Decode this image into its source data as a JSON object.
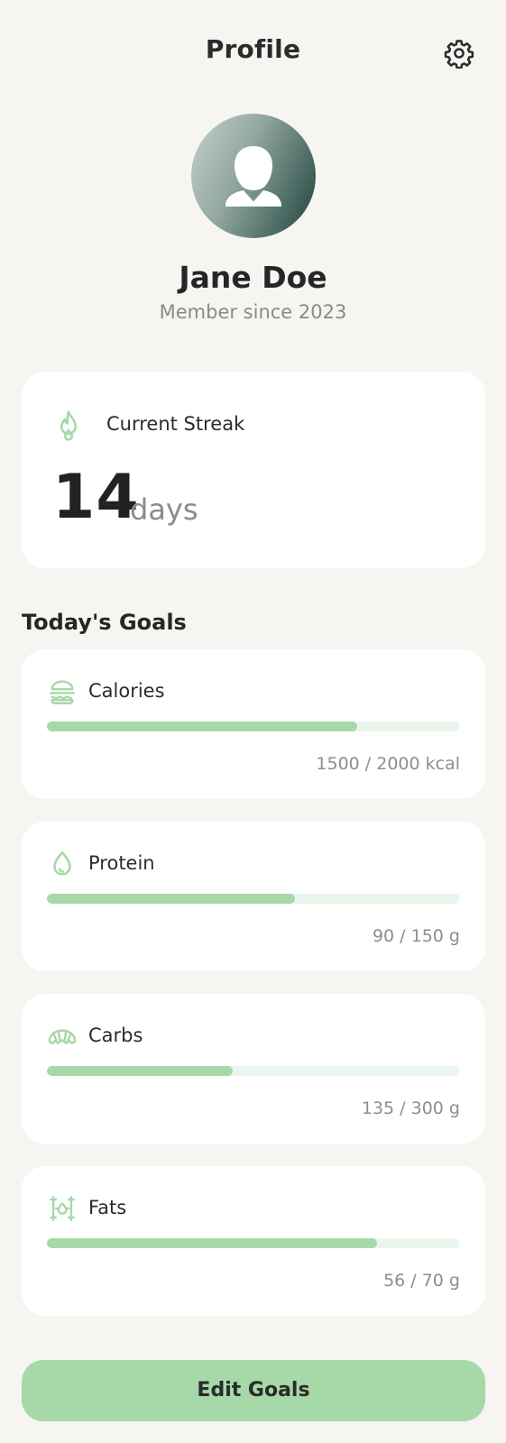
{
  "header": {
    "title": "Profile",
    "settings_icon": "gear-icon"
  },
  "profile": {
    "name": "Jane Doe",
    "member_since": "Member since 2023",
    "avatar_icon": "user-avatar-icon"
  },
  "streak": {
    "label": "Current Streak",
    "count": "14",
    "unit": "days",
    "icon": "flame-icon"
  },
  "goals": {
    "title": "Today's Goals",
    "items": [
      {
        "name": "Calories",
        "value": "1500 / 2000 kcal",
        "progress": 0.75,
        "icon": "burger-icon"
      },
      {
        "name": "Protein",
        "value": "90 / 150 g",
        "progress": 0.6,
        "icon": "drop-icon"
      },
      {
        "name": "Carbs",
        "value": "135 / 300 g",
        "progress": 0.45,
        "icon": "croissant-icon"
      },
      {
        "name": "Fats",
        "value": "56 / 70 g",
        "progress": 0.8,
        "icon": "oil-drop-icon"
      }
    ]
  },
  "actions": {
    "edit_goals": "Edit Goals"
  },
  "colors": {
    "accent": "#a6d9a7",
    "track": "#eaf5ec",
    "background": "#f6f5f2"
  }
}
